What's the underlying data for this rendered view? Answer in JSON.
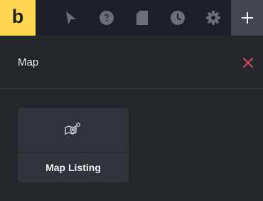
{
  "toolbar": {
    "logo_text": "b",
    "items": [
      {
        "icon": "cursor-icon"
      },
      {
        "icon": "help-icon"
      },
      {
        "icon": "page-icon"
      },
      {
        "icon": "history-icon"
      },
      {
        "icon": "gear-icon"
      },
      {
        "icon": "plus-icon",
        "active": true
      }
    ]
  },
  "search": {
    "value": "Map"
  },
  "elements": [
    {
      "label": "Map Listing",
      "icon": "map-pin-icon"
    }
  ],
  "colors": {
    "accent": "#ffd64f",
    "toolbar_bg": "#1d2026",
    "panel_bg": "#23262b",
    "card_bg": "#2f343b",
    "clear_icon": "#e0455a",
    "active_tab_bg": "#41464f"
  }
}
